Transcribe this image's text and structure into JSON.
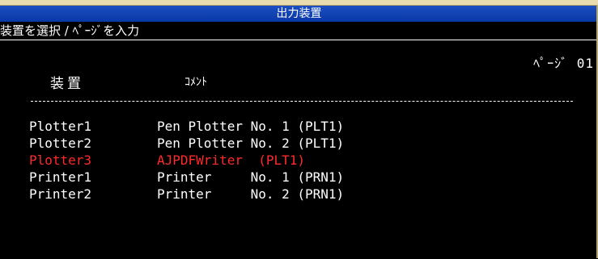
{
  "window": {
    "title": "出力装置",
    "prompt": "装置を選択 / ﾍﾟｰｼﾞを入力",
    "page_label": "ﾍﾟｰｼﾞ 01"
  },
  "table": {
    "header_device": "装置",
    "header_comment": "ｺﾒﾝﾄ",
    "rows": [
      {
        "name": "Plotter1",
        "comment": "Pen Plotter No. 1 (PLT1)",
        "selected": false
      },
      {
        "name": "Plotter2",
        "comment": "Pen Plotter No. 2 (PLT1)",
        "selected": false
      },
      {
        "name": "Plotter3",
        "comment": "AJPDFWriter  (PLT1)",
        "selected": true
      },
      {
        "name": "Printer1",
        "comment": "Printer     No. 1 (PRN1)",
        "selected": false
      },
      {
        "name": "Printer2",
        "comment": "Printer     No. 2 (PRN1)",
        "selected": false
      }
    ]
  },
  "colors": {
    "caption": "#0c3ba8",
    "background": "#000000",
    "text": "#ffffff",
    "selected": "#ff2a2a"
  }
}
